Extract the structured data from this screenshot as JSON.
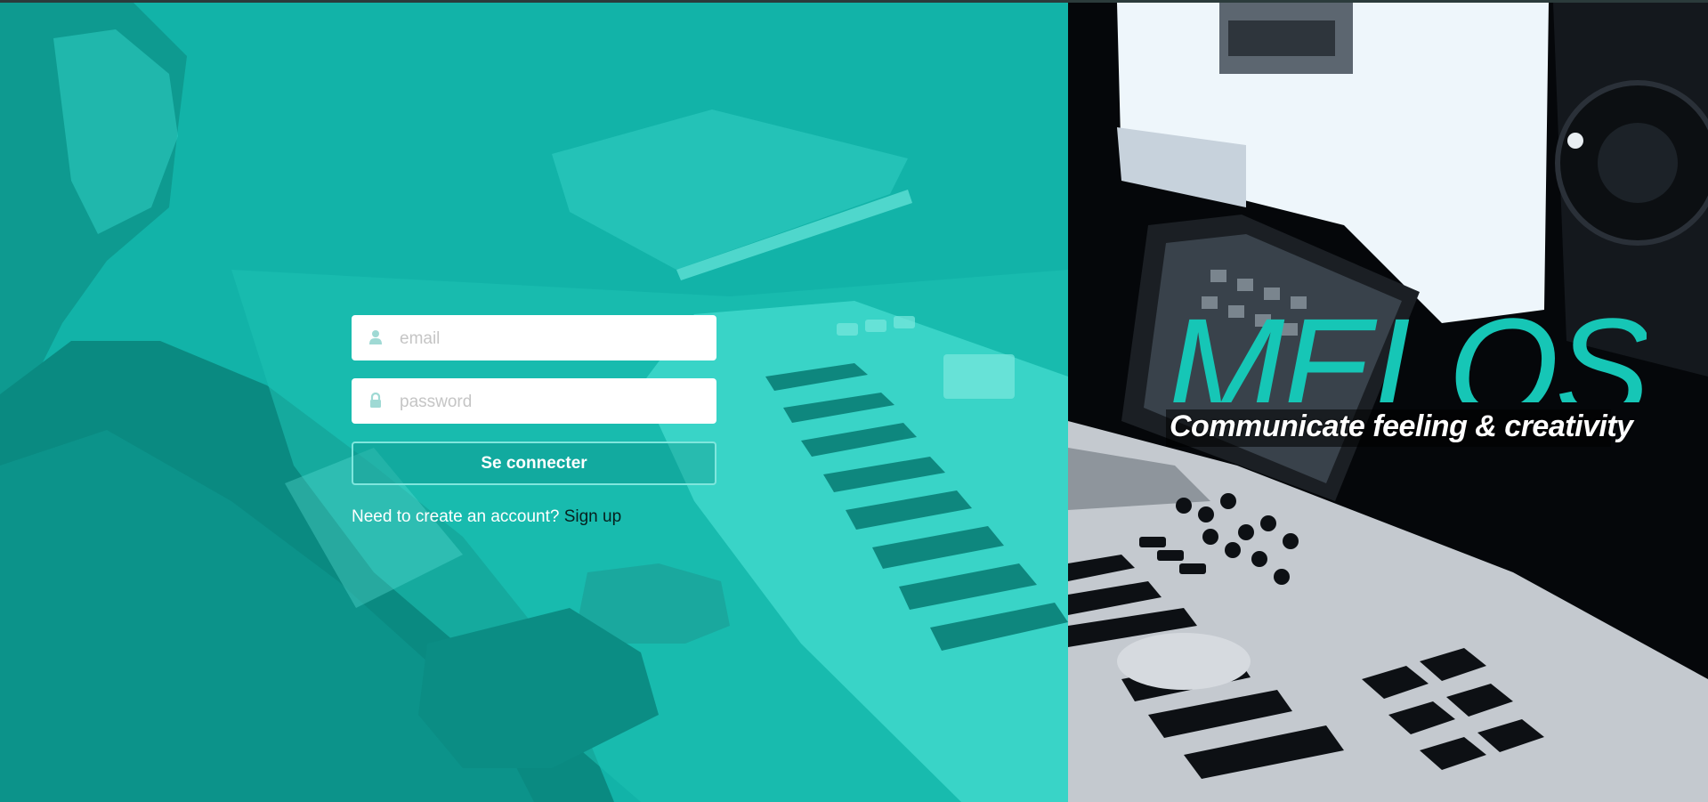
{
  "login": {
    "email_placeholder": "email",
    "password_placeholder": "password",
    "submit_label": "Se connecter",
    "signup_prompt": "Need to create an account?",
    "signup_link": "Sign up"
  },
  "brand": {
    "title": "MELOS",
    "tagline": "Communicate feeling & creativity"
  },
  "icons": {
    "email": "user-icon",
    "password": "lock-icon"
  },
  "colors": {
    "accent": "#12b3a8",
    "brand_title": "#16c6b6",
    "button_border": "#7fe6dd",
    "link": "#06201e"
  }
}
